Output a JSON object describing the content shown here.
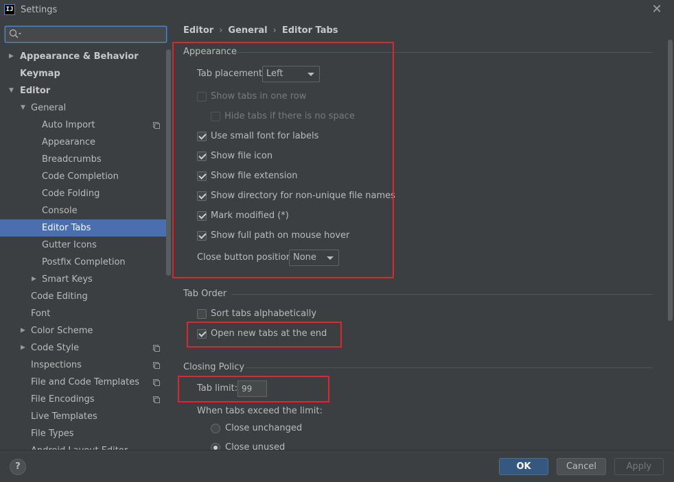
{
  "window": {
    "title": "Settings",
    "icon_text": "IJ"
  },
  "search": {
    "placeholder": ""
  },
  "sidebar": {
    "items": [
      {
        "label": "Appearance & Behavior"
      },
      {
        "label": "Keymap"
      },
      {
        "label": "Editor"
      },
      {
        "label": "General"
      },
      {
        "label": "Auto Import"
      },
      {
        "label": "Appearance"
      },
      {
        "label": "Breadcrumbs"
      },
      {
        "label": "Code Completion"
      },
      {
        "label": "Code Folding"
      },
      {
        "label": "Console"
      },
      {
        "label": "Editor Tabs"
      },
      {
        "label": "Gutter Icons"
      },
      {
        "label": "Postfix Completion"
      },
      {
        "label": "Smart Keys"
      },
      {
        "label": "Code Editing"
      },
      {
        "label": "Font"
      },
      {
        "label": "Color Scheme"
      },
      {
        "label": "Code Style"
      },
      {
        "label": "Inspections"
      },
      {
        "label": "File and Code Templates"
      },
      {
        "label": "File Encodings"
      },
      {
        "label": "Live Templates"
      },
      {
        "label": "File Types"
      },
      {
        "label": "Android Layout Editor"
      }
    ]
  },
  "breadcrumb": {
    "items": [
      "Editor",
      "General",
      "Editor Tabs"
    ],
    "separator": "›"
  },
  "appearance": {
    "title": "Appearance",
    "tab_placement_label": "Tab placement:",
    "tab_placement_value": "Left",
    "show_tabs_one_row": "Show tabs in one row",
    "hide_tabs_no_space": "Hide tabs if there is no space",
    "small_font": "Use small font for labels",
    "show_file_icon": "Show file icon",
    "show_file_extension": "Show file extension",
    "show_directory": "Show directory for non-unique file names",
    "mark_modified": "Mark modified (*)",
    "show_full_path": "Show full path on mouse hover",
    "close_button_label": "Close button position:",
    "close_button_value": "None"
  },
  "tab_order": {
    "title": "Tab Order",
    "sort_alpha": "Sort tabs alphabetically",
    "open_at_end": "Open new tabs at the end"
  },
  "closing_policy": {
    "title": "Closing Policy",
    "tab_limit_label": "Tab limit:",
    "tab_limit_value": "99",
    "exceed_label": "When tabs exceed the limit:",
    "close_unchanged": "Close unchanged",
    "close_unused": "Close unused"
  },
  "footer": {
    "help": "?",
    "ok": "OK",
    "cancel": "Cancel",
    "apply": "Apply"
  },
  "colors": {
    "accent": "#4b6eaf",
    "highlight_box": "#e0262a",
    "primary_button": "#365880"
  }
}
